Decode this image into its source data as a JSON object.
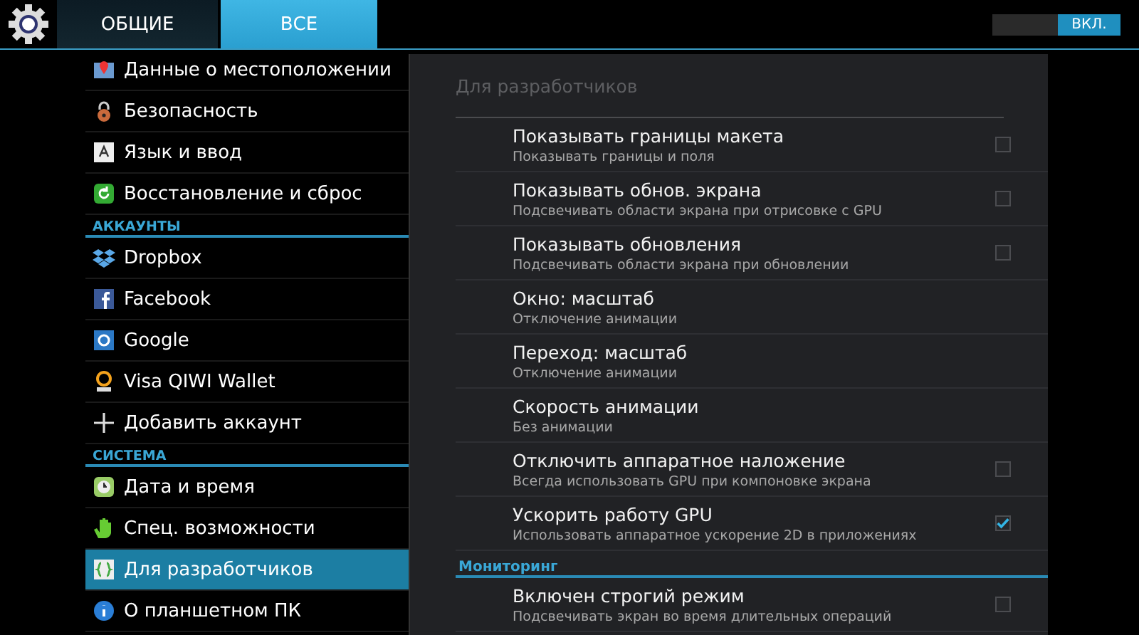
{
  "tabs": [
    {
      "label": "ОБЩИЕ",
      "selected": false
    },
    {
      "label": "ВСЕ",
      "selected": true
    }
  ],
  "toggle": {
    "label": "ВКЛ.",
    "on": true
  },
  "sidebar": [
    {
      "items": [
        {
          "label": "Данные о местоположении",
          "selected": false
        },
        {
          "label": "Безопасность",
          "selected": false
        },
        {
          "label": "Язык и ввод",
          "selected": false
        },
        {
          "label": "Восстановление и сброс",
          "selected": false
        }
      ]
    },
    {
      "title": "АККАУНТЫ",
      "items": [
        {
          "label": "Dropbox",
          "selected": false
        },
        {
          "label": "Facebook",
          "selected": false
        },
        {
          "label": "Google",
          "selected": false
        },
        {
          "label": "Visa QIWI Wallet",
          "selected": false
        },
        {
          "label": "Добавить аккаунт",
          "selected": false
        }
      ]
    },
    {
      "title": "СИСТЕМА",
      "items": [
        {
          "label": "Дата и время",
          "selected": false
        },
        {
          "label": "Спец. возможности",
          "selected": false
        },
        {
          "label": "Для разработчиков",
          "selected": true
        },
        {
          "label": "О планшетном ПК",
          "selected": false
        }
      ]
    }
  ],
  "panel": {
    "title": "Для разработчиков",
    "groups": [
      {
        "rows": [
          {
            "kind": "checkbox",
            "title": "Показывать границы макета",
            "subtitle": "Показывать границы и поля",
            "checked": false
          },
          {
            "kind": "checkbox",
            "title": "Показывать обнов. экрана",
            "subtitle": "Подсвечивать области экрана при отрисовке с GPU",
            "checked": false
          },
          {
            "kind": "checkbox",
            "title": "Показывать обновления",
            "subtitle": "Подсвечивать области экрана при обновлении",
            "checked": false
          },
          {
            "kind": "plain",
            "title": "Окно: масштаб",
            "subtitle": "Отключение анимации"
          },
          {
            "kind": "plain",
            "title": "Переход: масштаб",
            "subtitle": "Отключение анимации"
          },
          {
            "kind": "plain",
            "title": "Скорость анимации",
            "subtitle": "Без анимации"
          },
          {
            "kind": "checkbox",
            "title": "Отключить аппаратное наложение",
            "subtitle": "Всегда использовать GPU при компоновке экрана",
            "checked": false
          },
          {
            "kind": "checkbox",
            "title": "Ускорить работу GPU",
            "subtitle": "Использовать аппаратное ускорение 2D в приложениях",
            "checked": true
          }
        ]
      },
      {
        "title": "Мониторинг",
        "rows": [
          {
            "kind": "checkbox",
            "title": "Включен строгий режим",
            "subtitle": "Подсвечивать экран во время длительных операций",
            "checked": false
          }
        ]
      }
    ]
  }
}
